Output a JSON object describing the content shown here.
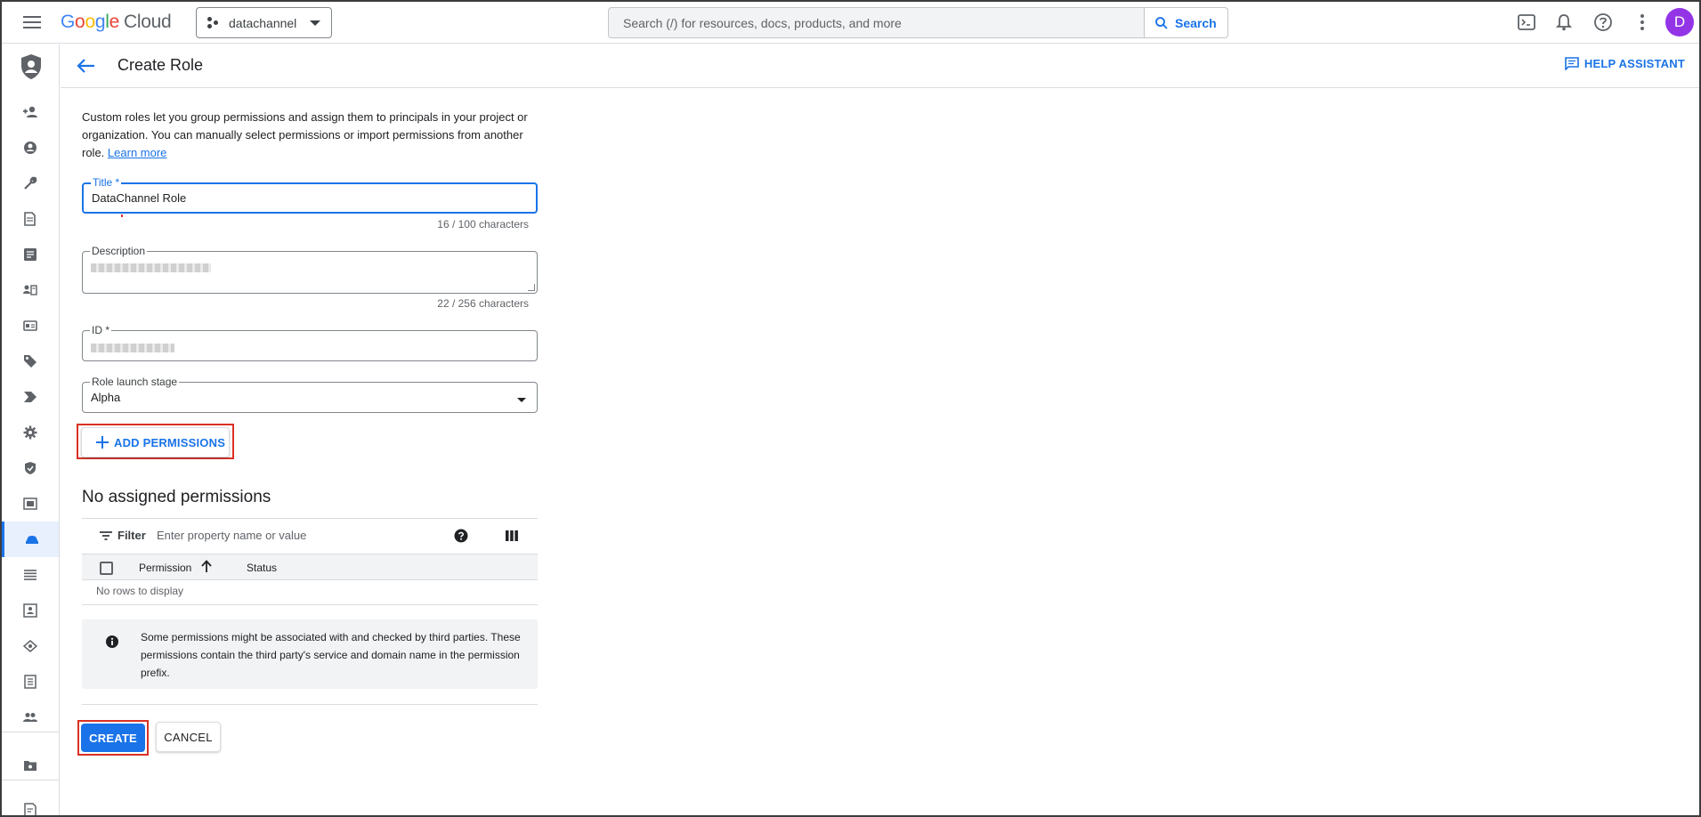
{
  "topbar": {
    "logo": {
      "g": "G",
      "o1": "o",
      "o2": "o",
      "g2": "g",
      "l": "l",
      "e": "e",
      "cloud": "Cloud"
    },
    "project": "datachannel",
    "search_placeholder": "Search (/) for resources, docs, products, and more",
    "search_button": "Search",
    "avatar_initial": "D"
  },
  "header": {
    "title": "Create Role",
    "help_assistant": "HELP ASSISTANT"
  },
  "form": {
    "intro_text": "Custom roles let you group permissions and assign them to principals in your project or organization. You can manually select permissions or import permissions from another role.",
    "learn_more": "Learn more",
    "title_label": "Title *",
    "title_value": "DataChannel Role",
    "title_counter": "16 / 100 characters",
    "description_label": "Description",
    "description_counter": "22 / 256 characters",
    "id_label": "ID *",
    "launch_stage_label": "Role launch stage",
    "launch_stage_value": "Alpha",
    "add_permissions": "ADD PERMISSIONS"
  },
  "permissions": {
    "section_title": "No assigned permissions",
    "filter_label": "Filter",
    "filter_placeholder": "Enter property name or value",
    "columns": [
      "Permission",
      "Status"
    ],
    "empty_text": "No rows to display",
    "info_text": "Some permissions might be associated with and checked by third parties. These permissions contain the third party's service and domain name in the permission prefix."
  },
  "actions": {
    "create": "CREATE",
    "cancel": "CANCEL"
  },
  "colors": {
    "accent": "#1a73e8",
    "highlight": "#d93025",
    "avatar": "#9334e6"
  },
  "rail_icons": [
    "add-person-icon",
    "account-circle-icon",
    "wrench-icon",
    "policy-doc-icon",
    "logs-icon",
    "service-account-icon",
    "id-card-icon",
    "tag-icon",
    "label-icon",
    "settings-icon",
    "shield-icon",
    "workload-identity-icon",
    "roles-icon",
    "list-icon",
    "org-icon",
    "privacy-icon",
    "quota-icon",
    "groups-icon",
    "folder-settings-icon",
    "release-notes-icon"
  ]
}
